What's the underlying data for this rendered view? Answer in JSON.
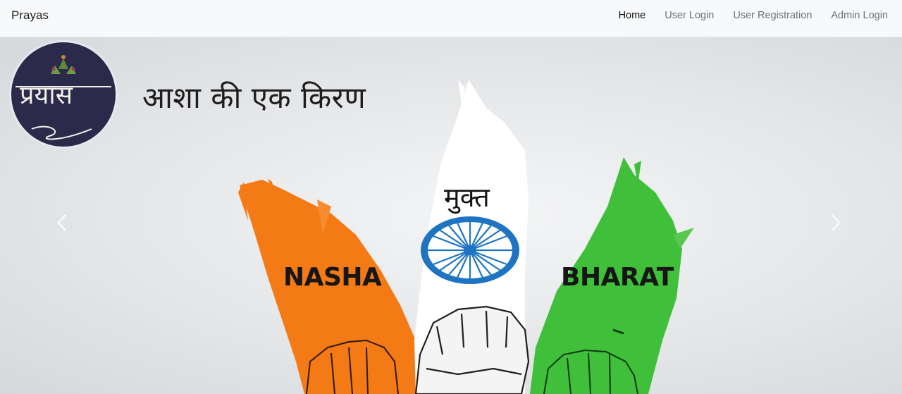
{
  "navbar": {
    "brand": "Prayas",
    "links": [
      {
        "label": "Home",
        "active": true
      },
      {
        "label": "User Login",
        "active": false
      },
      {
        "label": "User Registration",
        "active": false
      },
      {
        "label": "Admin Login",
        "active": false
      }
    ]
  },
  "carousel": {
    "slide": {
      "logo_text": "प्रयास",
      "tagline": "आशा की एक किरण",
      "center_word": "मुक्त",
      "left_word": "NASHA",
      "right_word": "BHARAT"
    },
    "controls": {
      "prev_icon": "chevron-left-icon",
      "next_icon": "chevron-right-icon"
    },
    "colors": {
      "saffron": "#f47a15",
      "white": "#ffffff",
      "green": "#3fbf3a",
      "chakra": "#1e74c2",
      "logo_bg": "#2b2a4a"
    }
  }
}
